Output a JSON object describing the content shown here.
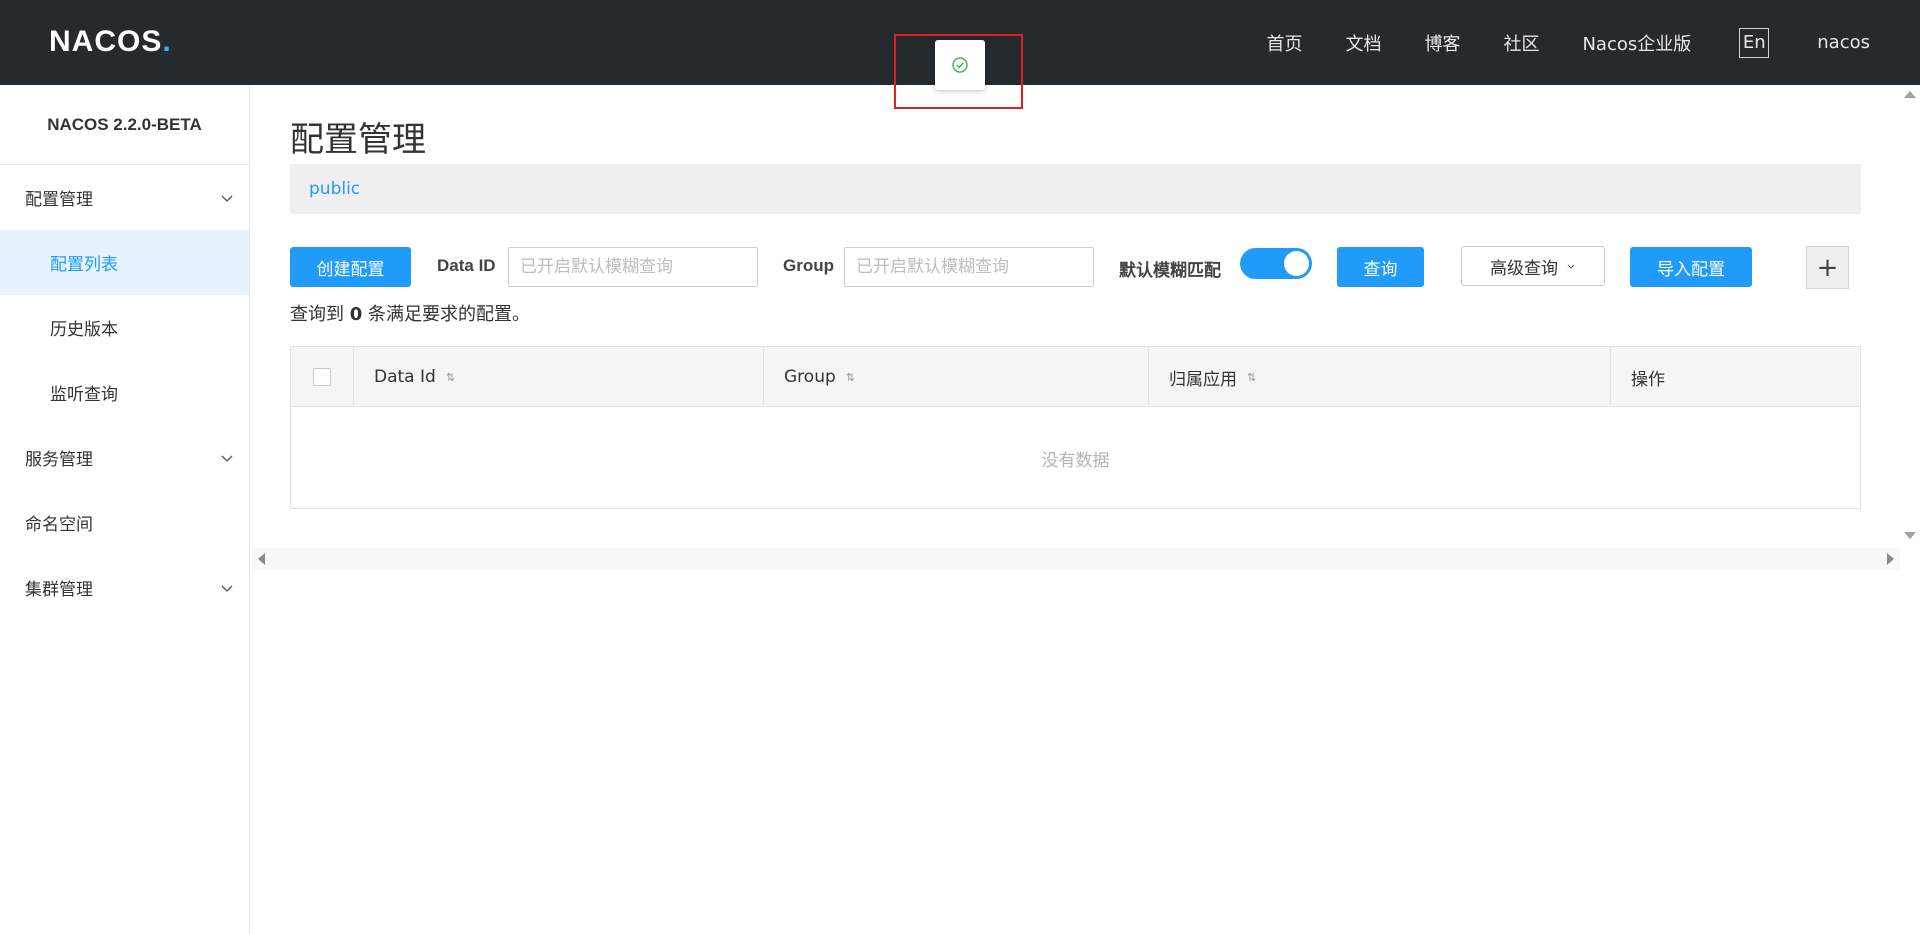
{
  "header": {
    "logo_text": "NACOS",
    "logo_dot": ".",
    "nav": [
      "首页",
      "文档",
      "博客",
      "社区",
      "Nacos企业版"
    ],
    "lang_button": "En",
    "user": "nacos"
  },
  "toast": {
    "icon": "check-circle-icon"
  },
  "sidebar": {
    "version": "NACOS 2.2.0-BETA",
    "config_group": "配置管理",
    "config_items": [
      "配置列表",
      "历史版本",
      "监听查询"
    ],
    "service_group": "服务管理",
    "namespace": "命名空间",
    "cluster_group": "集群管理"
  },
  "main": {
    "title": "配置管理",
    "namespace": "public",
    "create_button": "创建配置",
    "data_id_label": "Data ID",
    "data_id_placeholder": "已开启默认模糊查询",
    "group_label": "Group",
    "group_placeholder": "已开启默认模糊查询",
    "fuzzy_label": "默认模糊匹配",
    "fuzzy_enabled": true,
    "query_button": "查询",
    "advanced_button": "高级查询",
    "import_button": "导入配置",
    "plus_button": "+",
    "result_prefix": "查询到",
    "result_count": "0",
    "result_suffix": "条满足要求的配置。"
  },
  "table": {
    "columns": [
      "Data Id",
      "Group",
      "归属应用",
      "操作"
    ],
    "empty_text": "没有数据"
  },
  "colors": {
    "primary": "#209bfa",
    "header_bg": "#252a2f",
    "active_menu_bg": "#e6f3fd"
  }
}
